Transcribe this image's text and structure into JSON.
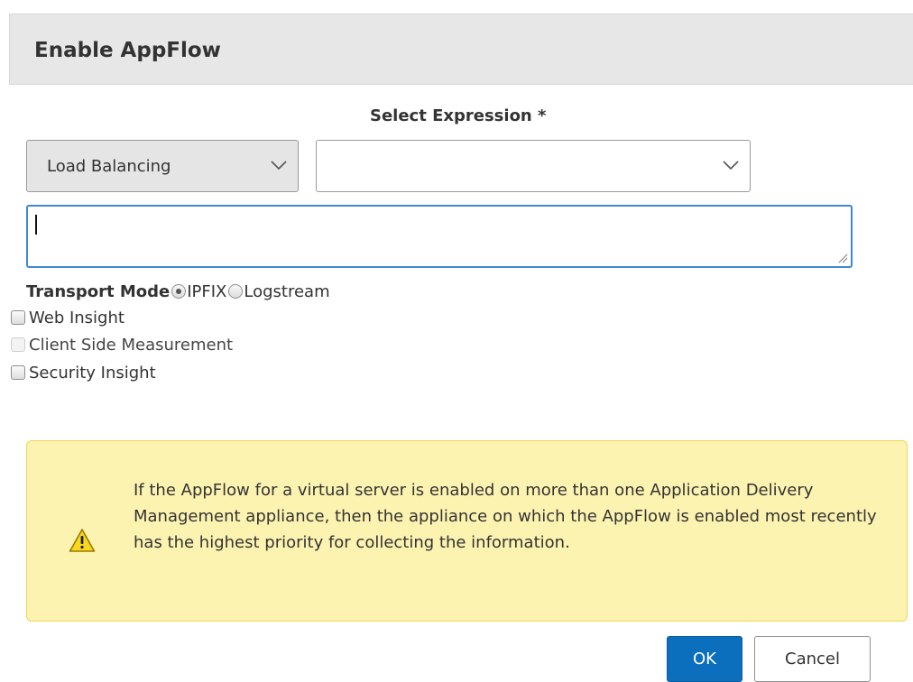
{
  "dialog": {
    "title": "Enable AppFlow"
  },
  "expression": {
    "label": "Select Expression *",
    "category_value": "Load Balancing",
    "expression_value": "",
    "textarea_value": ""
  },
  "transport_mode": {
    "label": "Transport Mode",
    "options": [
      {
        "label": "IPFIX",
        "selected": true
      },
      {
        "label": "Logstream",
        "selected": false
      }
    ]
  },
  "checkboxes": [
    {
      "label": "Web Insight",
      "checked": false,
      "disabled": false
    },
    {
      "label": "Client Side Measurement",
      "checked": false,
      "disabled": true
    },
    {
      "label": "Security Insight",
      "checked": false,
      "disabled": false
    }
  ],
  "warning": {
    "icon": "warning-icon",
    "text": "If the AppFlow for a virtual server is enabled on more than one Application Delivery Management appliance, then the appliance on which the AppFlow is enabled most recently has the highest priority for collecting the information."
  },
  "buttons": {
    "ok_label": "OK",
    "cancel_label": "Cancel"
  },
  "colors": {
    "primary_button": "#0b6fbe",
    "warning_background": "#fdf3b1",
    "warning_border": "#f0d55b",
    "focus_border": "#3f88d6"
  }
}
